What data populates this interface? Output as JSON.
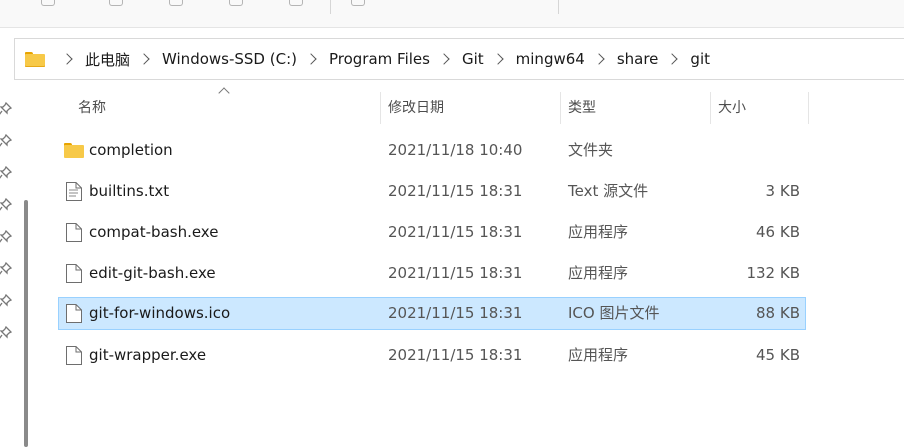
{
  "breadcrumb": [
    "此电脑",
    "Windows-SSD (C:)",
    "Program Files",
    "Git",
    "mingw64",
    "share",
    "git"
  ],
  "columns": {
    "name": "名称",
    "modified": "修改日期",
    "type": "类型",
    "size": "大小"
  },
  "rows": [
    {
      "name": "completion",
      "date": "2021/11/18 10:40",
      "type": "文件夹",
      "size": "",
      "icon": "folder-icon",
      "selected": false
    },
    {
      "name": "builtins.txt",
      "date": "2021/11/15 18:31",
      "type": "Text 源文件",
      "size": "3 KB",
      "icon": "text-file-icon",
      "selected": false
    },
    {
      "name": "compat-bash.exe",
      "date": "2021/11/15 18:31",
      "type": "应用程序",
      "size": "46 KB",
      "icon": "file-icon",
      "selected": false
    },
    {
      "name": "edit-git-bash.exe",
      "date": "2021/11/15 18:31",
      "type": "应用程序",
      "size": "132 KB",
      "icon": "file-icon",
      "selected": false
    },
    {
      "name": "git-for-windows.ico",
      "date": "2021/11/15 18:31",
      "type": "ICO 图片文件",
      "size": "88 KB",
      "icon": "file-icon",
      "selected": true
    },
    {
      "name": "git-wrapper.exe",
      "date": "2021/11/15 18:31",
      "type": "应用程序",
      "size": "45 KB",
      "icon": "file-icon",
      "selected": false
    }
  ],
  "colors": {
    "selection_bg": "#cce8ff",
    "selection_border": "#99d1ff",
    "folder": "#f7c948"
  }
}
